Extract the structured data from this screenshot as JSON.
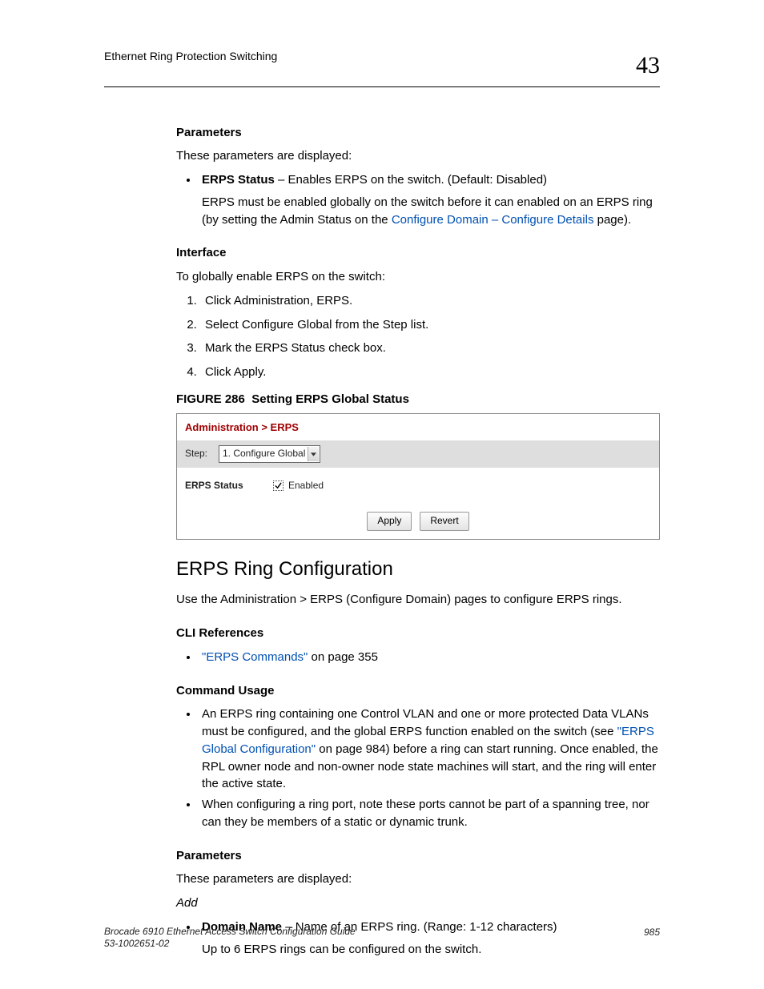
{
  "header": {
    "title": "Ethernet Ring Protection Switching",
    "chapter": "43"
  },
  "p1": {
    "h": "Parameters",
    "intro": "These parameters are displayed:",
    "bullet_term": "ERPS Status",
    "bullet_text": " – Enables ERPS on the switch. (Default: Disabled)",
    "bullet_sub_a": "ERPS must be enabled globally on the switch before it can enabled on an ERPS ring (by setting the Admin Status on the ",
    "bullet_link": "Configure Domain – Configure Details",
    "bullet_sub_b": " page)."
  },
  "iface": {
    "h": "Interface",
    "intro": "To globally enable ERPS on the switch:",
    "s1": "Click Administration, ERPS.",
    "s2": "Select Configure Global from the Step list.",
    "s3": "Mark the ERPS Status check box.",
    "s4": "Click Apply."
  },
  "figure": {
    "label": "FIGURE 286",
    "caption": "Setting ERPS Global Status",
    "breadcrumb": "Administration > ERPS",
    "step_label": "Step:",
    "step_value": "1. Configure Global",
    "status_label": "ERPS Status",
    "enabled_label": "Enabled",
    "apply": "Apply",
    "revert": "Revert"
  },
  "ring": {
    "title": "ERPS Ring Configuration",
    "intro": "Use the Administration > ERPS (Configure Domain) pages to configure ERPS rings.",
    "cli_h": "CLI References",
    "cli_link": "\"ERPS Commands\"",
    "cli_tail": " on page 355",
    "cu_h": "Command Usage",
    "cu1_a": "An ERPS ring containing one Control VLAN and one or more protected Data VLANs must be configured, and the global ERPS function enabled on the switch (see ",
    "cu1_link": "\"ERPS Global Configuration\"",
    "cu1_b": " on page 984) before a ring can start running. Once enabled, the RPL owner node and non-owner node state machines will start, and the ring will enter the active state.",
    "cu2": "When configuring a ring port, note these ports cannot be part of a spanning tree, nor can they be members of a static or dynamic trunk.",
    "params_h": "Parameters",
    "params_intro": "These parameters are displayed:",
    "add": "Add",
    "dn_term": "Domain Name",
    "dn_text": " – Name of an ERPS ring. (Range: 1-12 characters)",
    "dn_sub": "Up to 6 ERPS rings can be configured on the switch."
  },
  "footer": {
    "line1": "Brocade 6910 Ethernet Access Switch Configuration Guide",
    "line2": "53-1002651-02",
    "page": "985"
  }
}
